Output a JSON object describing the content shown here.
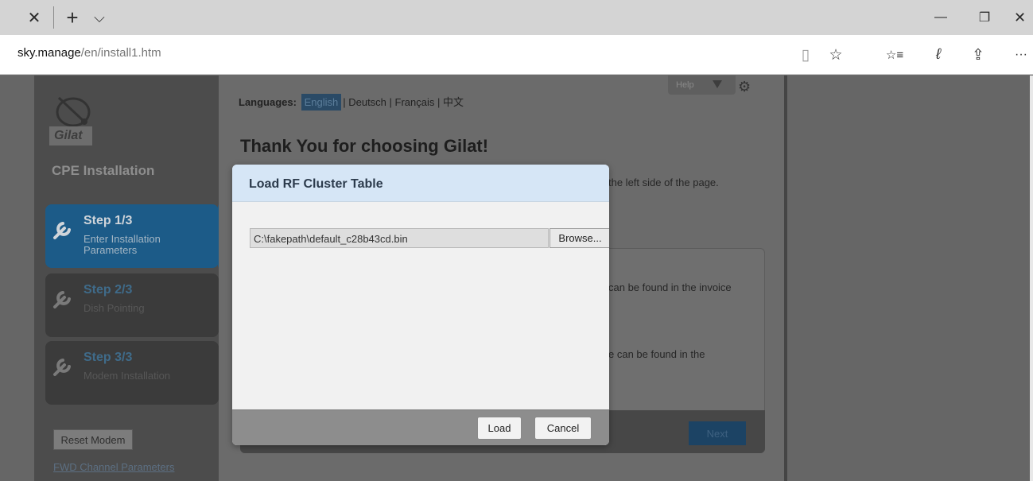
{
  "browser": {
    "url_host": "sky.manage",
    "url_path": "/en/install1.htm",
    "controls": {
      "close_tab": "✕",
      "new_tab": "+",
      "tab_list": "⌵",
      "minimize": "—",
      "restore": "❐",
      "close_window": "✕",
      "reading_view": "▯",
      "favorite": "☆",
      "favorites_hub": "☆≡",
      "notes": "ℓ",
      "share": "⇪",
      "more": "···"
    }
  },
  "sidebar": {
    "logo_text": "Gilat",
    "title": "CPE Installation",
    "steps": [
      {
        "title": "Step 1/3",
        "subtitle": "Enter Installation Parameters",
        "active": true
      },
      {
        "title": "Step 2/3",
        "subtitle": "Dish Pointing",
        "active": false
      },
      {
        "title": "Step 3/3",
        "subtitle": "Modem Installation",
        "active": false
      }
    ],
    "reset_label": "Reset Modem",
    "fwd_link": "FWD Channel Parameters"
  },
  "main": {
    "help_label": "Help",
    "languages_label": "Languages:",
    "lang_selected": "English",
    "lang_others": "| Deutsch | Français | 中文",
    "heading": "Thank You for choosing Gilat!",
    "partial_line_1": "the left side of the page.",
    "partial_line_2": "can be found in the invoice",
    "partial_line_3": "e can be found in the",
    "next_label": "Next"
  },
  "modal": {
    "title": "Load RF Cluster Table",
    "file_value": "C:\\fakepath\\default_c28b43cd.bin",
    "browse_label": "Browse...",
    "load_label": "Load",
    "cancel_label": "Cancel"
  },
  "colors": {
    "active_step": "#1c5b88",
    "modal_header": "#d6e6f6",
    "overlay": "#666666"
  }
}
